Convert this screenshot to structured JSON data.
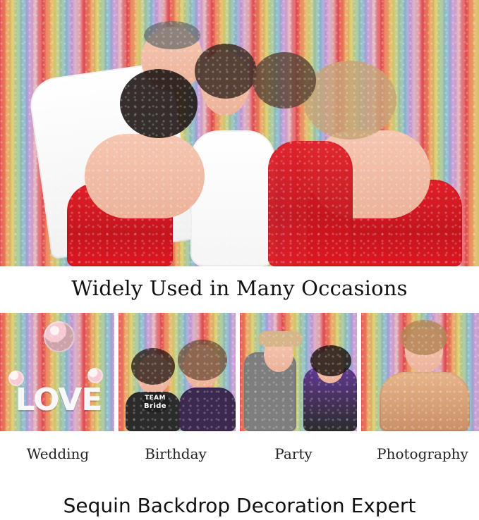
{
  "headline": "Widely Used in Many Occasions",
  "occasions": [
    {
      "label": "Wedding"
    },
    {
      "label": "Birthday"
    },
    {
      "label": "Party"
    },
    {
      "label": "Photography"
    }
  ],
  "thumb_text": {
    "wedding_sign": "LOVE",
    "birthday_sign_line1": "TEAM",
    "birthday_sign_line2": "Bride"
  },
  "tagline": "Sequin Backdrop Decoration Expert",
  "colors": {
    "text": "#111111",
    "dress_red": "#c61a23",
    "background": "#ffffff"
  },
  "icons": {
    "hero_image": "group-photo",
    "thumb_images": [
      "wedding-photo",
      "birthday-photo",
      "party-photo",
      "portrait-photo"
    ]
  }
}
